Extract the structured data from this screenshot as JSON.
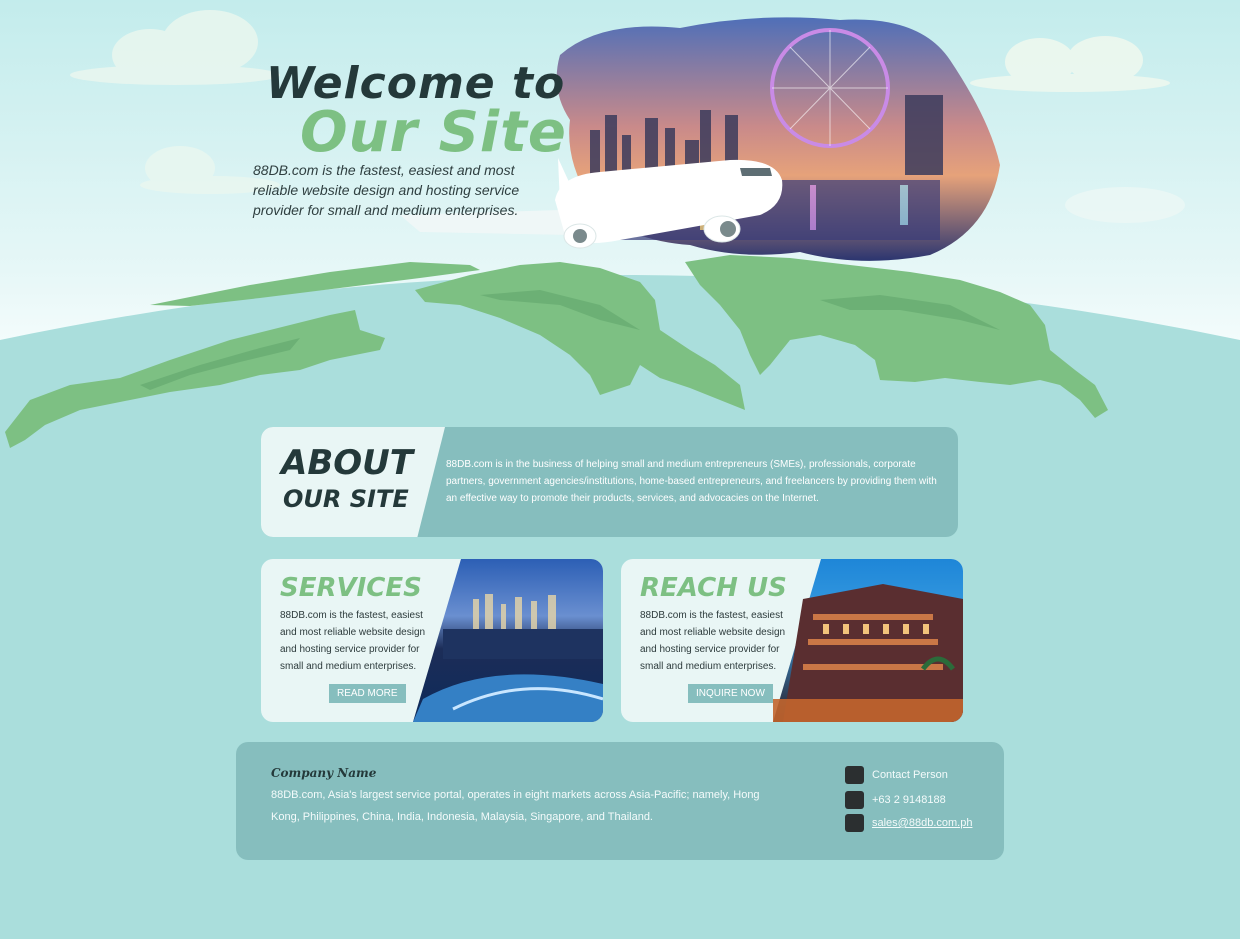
{
  "hero": {
    "title_line1": "Welcome to",
    "title_line2": "Our Site",
    "description": "88DB.com is the fastest, easiest and most reliable website design and hosting service provider for small and medium enterprises."
  },
  "about": {
    "heading_line1": "ABOUT",
    "heading_line2": "OUR SITE",
    "text": "88DB.com is in the business of helping small and medium entrepreneurs (SMEs), professionals, corporate partners, government agencies/institutions, home-based entrepreneurs, and freelancers by providing them with an effective way to promote their products, services, and advocacies on the Internet."
  },
  "services": {
    "title": "SERVICES",
    "text": "88DB.com is the fastest, easiest and most reliable website design and hosting service provider for small and medium enterprises.",
    "button_label": "READ MORE"
  },
  "reach": {
    "title": "REACH US",
    "text": "88DB.com is the fastest, easiest and most reliable website design and hosting service provider for small and medium enterprises.",
    "button_label": "INQUIRE NOW"
  },
  "footer": {
    "company_name": "Company Name",
    "text": "88DB.com, Asia's largest service portal, operates in eight markets across Asia-Pacific; namely, Hong Kong, Philippines, China, India, Indonesia, Malaysia, Singapore, and Thailand.",
    "contact_person": "Contact Person",
    "phone": "+63 2 9148188",
    "email": "sales@88db.com.ph"
  },
  "colors": {
    "background": "#aadedc",
    "sky": "#c6eeee",
    "land_green": "#7dc083",
    "dark_text": "#24393a",
    "panel_teal": "#86bebe",
    "card_light": "#e9f6f5"
  },
  "icons": [
    "user-icon",
    "phone-icon",
    "email-icon"
  ]
}
